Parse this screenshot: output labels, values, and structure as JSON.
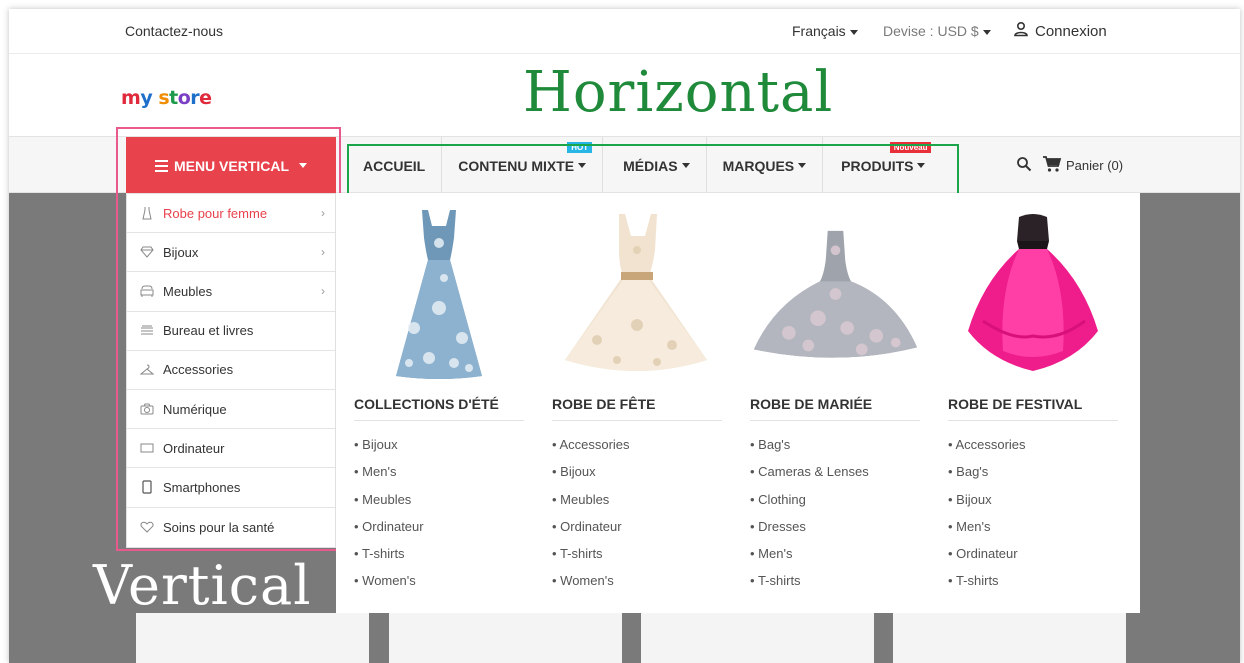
{
  "topbar": {
    "contact": "Contactez-nous",
    "language": "Français",
    "currency": "Devise : USD $",
    "login": "Connexion"
  },
  "header": {
    "logo": "my store",
    "overlay_title": "Horizontal"
  },
  "vertical_menu": {
    "button_label": "MENU VERTICAL",
    "items": [
      {
        "label": "Robe pour femme",
        "icon": "dress-icon",
        "has_submenu": true,
        "active": true
      },
      {
        "label": "Bijoux",
        "icon": "diamond-icon",
        "has_submenu": true
      },
      {
        "label": "Meubles",
        "icon": "sofa-icon",
        "has_submenu": true
      },
      {
        "label": "Bureau et livres",
        "icon": "books-icon",
        "has_submenu": false
      },
      {
        "label": "Accessories",
        "icon": "hanger-icon",
        "has_submenu": false
      },
      {
        "label": "Numérique",
        "icon": "camera-icon",
        "has_submenu": false
      },
      {
        "label": "Ordinateur",
        "icon": "monitor-icon",
        "has_submenu": false
      },
      {
        "label": "Smartphones",
        "icon": "phone-icon",
        "has_submenu": false
      },
      {
        "label": "Soins pour la santé",
        "icon": "heart-icon",
        "has_submenu": false
      }
    ],
    "overlay_title": "Vertical"
  },
  "horizontal_menu": {
    "items": [
      {
        "label": "ACCUEIL",
        "dropdown": false
      },
      {
        "label": "CONTENU MIXTE",
        "dropdown": true,
        "tag": "HOT"
      },
      {
        "label": "MÉDIAS",
        "dropdown": true
      },
      {
        "label": "MARQUES",
        "dropdown": true
      },
      {
        "label": "PRODUITS",
        "dropdown": true,
        "tag": "Nouveau"
      }
    ]
  },
  "tools": {
    "cart": "Panier (0)"
  },
  "mega_menu": {
    "columns": [
      {
        "title": "COLLECTIONS D'ÉTÉ",
        "image": "blue-floral-dress",
        "links": [
          "Bijoux",
          "Men's",
          "Meubles",
          "Ordinateur",
          "T-shirts",
          "Women's"
        ]
      },
      {
        "title": "ROBE DE FÊTE",
        "image": "cream-lace-dress",
        "links": [
          "Accessories",
          "Bijoux",
          "Meubles",
          "Ordinateur",
          "T-shirts",
          "Women's"
        ]
      },
      {
        "title": "ROBE DE MARIÉE",
        "image": "grey-floral-ballgown",
        "links": [
          "Bag's",
          "Cameras & Lenses",
          "Clothing",
          "Dresses",
          "Men's",
          "T-shirts"
        ]
      },
      {
        "title": "ROBE DE FESTIVAL",
        "image": "pink-highlow-dress",
        "links": [
          "Accessories",
          "Bag's",
          "Bijoux",
          "Men's",
          "Ordinateur",
          "T-shirts"
        ]
      }
    ]
  },
  "colors": {
    "accent_red": "#e8424c",
    "hot_tag": "#26b5e4",
    "new_tag": "#e8303b",
    "horizontal_outline": "#1aa54a",
    "vertical_outline": "#e85a8c",
    "horizontal_title": "#1e8a3a"
  }
}
